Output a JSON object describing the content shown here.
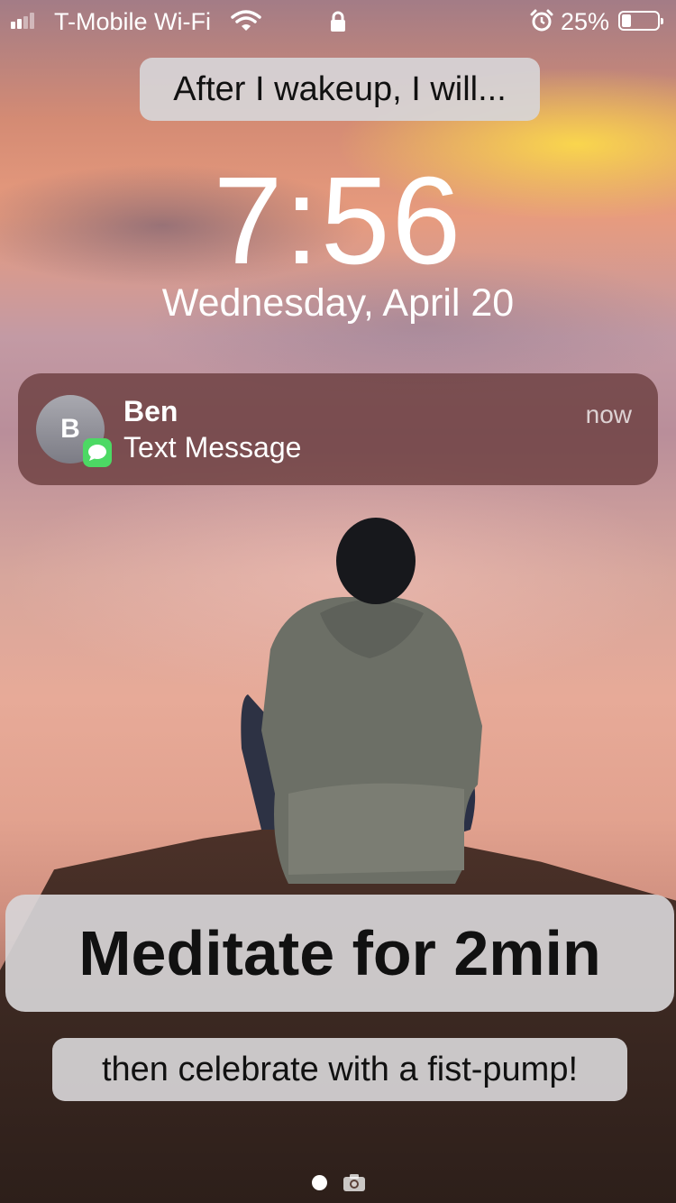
{
  "status_bar": {
    "carrier": "T-Mobile Wi-Fi",
    "battery_percent": "25%",
    "battery_level": 0.25,
    "signal_bars": 2,
    "icons": [
      "signal-bars-icon",
      "wifi-icon",
      "lock-icon",
      "alarm-icon",
      "battery-icon"
    ]
  },
  "lockscreen": {
    "prompt": "After I wakeup, I will...",
    "time": "7:56",
    "date": "Wednesday, April 20"
  },
  "notification": {
    "avatar_initial": "B",
    "sender": "Ben",
    "preview": "Text Message",
    "timestamp": "now",
    "app_icon": "messages-icon",
    "app_color": "#4cd964"
  },
  "overlay": {
    "habit": "Meditate for 2min",
    "celebration": "then celebrate with a fist-pump!"
  },
  "bottom": {
    "icons": [
      "page-dot-icon",
      "camera-icon"
    ]
  }
}
